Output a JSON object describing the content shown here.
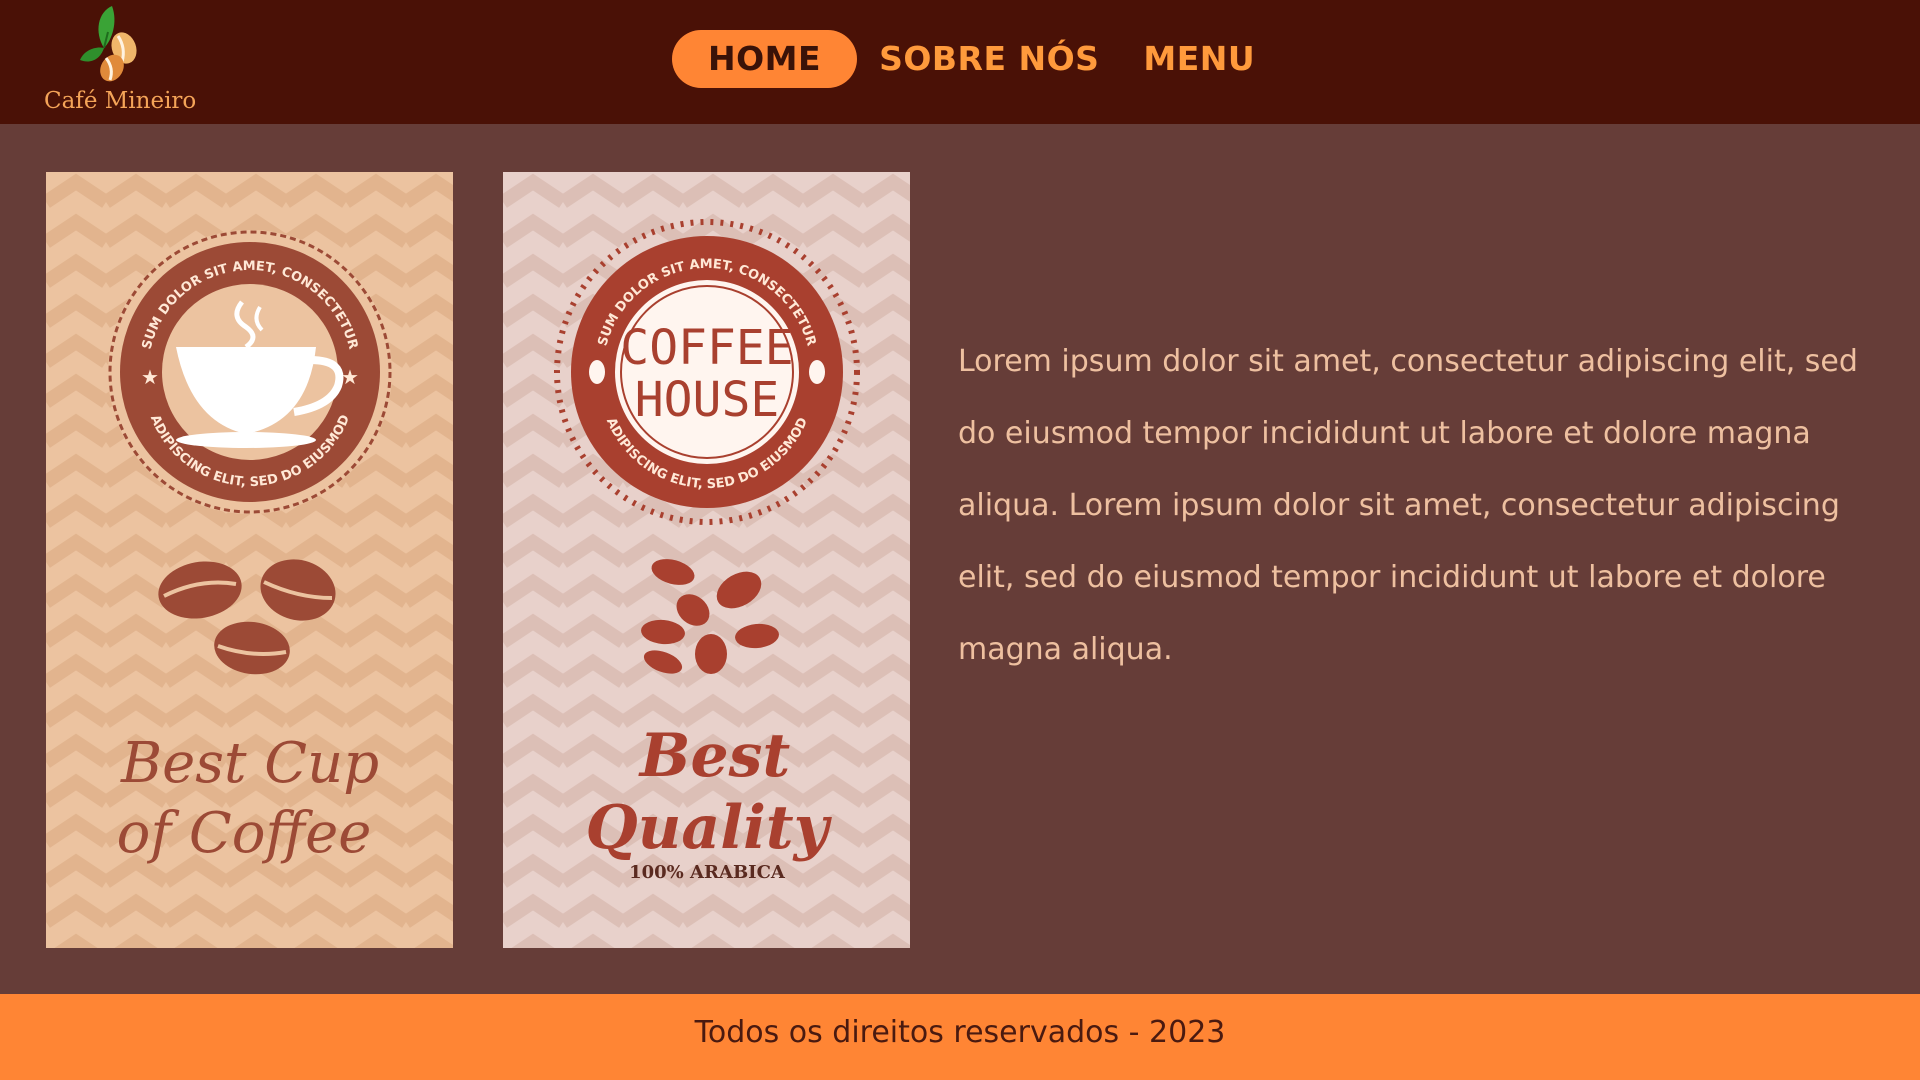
{
  "brand": {
    "name": "Café Mineiro"
  },
  "nav": {
    "items": [
      {
        "label": "HOME",
        "active": true
      },
      {
        "label": "SOBRE NÓS",
        "active": false
      },
      {
        "label": "MENU",
        "active": false
      }
    ]
  },
  "cards": [
    {
      "badge_text_top": "SUM DOLOR SIT AMET, CONSECTETUR",
      "badge_text_bottom": "ADIPISCING ELIT, SED DO EIUSMOD",
      "headline_line1": "Best Cup",
      "headline_line2": "of Coffee"
    },
    {
      "badge_text_top": "SUM DOLOR SIT AMET, CONSECTETUR",
      "badge_text_bottom": "ADIPISCING ELIT, SED DO EIUSMOD",
      "badge_title_line1": "COFFEE",
      "badge_title_line2": "HOUSE",
      "headline_line1": "Best",
      "headline_line2": "Quality",
      "tagline": "100% ARABICA"
    }
  ],
  "main": {
    "description": "Lorem ipsum dolor sit amet, consectetur adipiscing elit, sed do eiusmod tempor incididunt ut labore et dolore magna aliqua.  Lorem ipsum dolor sit amet, consectetur adipiscing elit, sed do eiusmod tempor incididunt ut labore et dolore magna aliqua."
  },
  "footer": {
    "text": "Todos os direitos reservados - 2023"
  },
  "colors": {
    "header_bg": "#4a1106",
    "page_bg": "#663d38",
    "accent": "#ff8534",
    "nav_text": "#ff9a3c",
    "body_text": "#eec0a0"
  }
}
